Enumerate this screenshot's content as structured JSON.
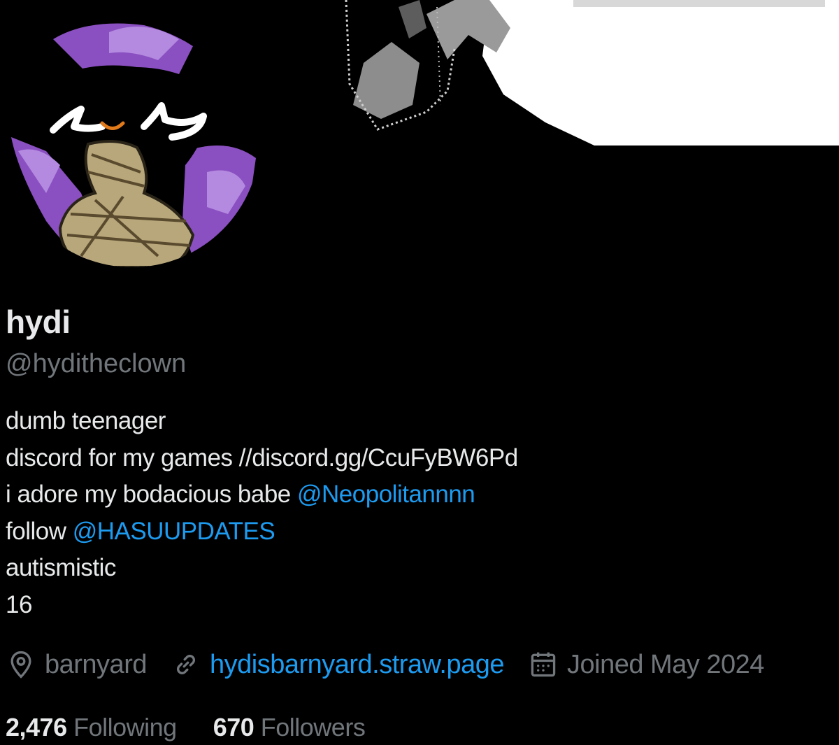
{
  "profile": {
    "display_name": "hydi",
    "handle": "@hyditheclown",
    "avatar_icon": "clown-avatar-image",
    "banner_icon": "drawn-banner-image"
  },
  "bio": {
    "line1": "dumb teenager",
    "line2": "discord for my games //discord.gg/CcuFyBW6Pd",
    "line3_prefix": "i adore my bodacious babe ",
    "line3_mention": "@Neopolitannnn",
    "line4_prefix": "follow ",
    "line4_mention": "@HASUUPDATES",
    "line5": "autismistic",
    "line6": "16"
  },
  "meta": {
    "location": "barnyard",
    "website": "hydisbarnyard.straw.page",
    "joined": "Joined May 2024",
    "location_icon": "location-pin-icon",
    "link_icon": "link-icon",
    "calendar_icon": "calendar-icon"
  },
  "stats": {
    "following_count": "2,476",
    "following_label": "Following",
    "followers_count": "670",
    "followers_label": "Followers"
  },
  "colors": {
    "background": "#000000",
    "text_primary": "#e7e9ea",
    "text_secondary": "#71767b",
    "link": "#1d9bf0",
    "avatar_purple": "#8a4fc0",
    "avatar_tan": "#b8a77a"
  }
}
